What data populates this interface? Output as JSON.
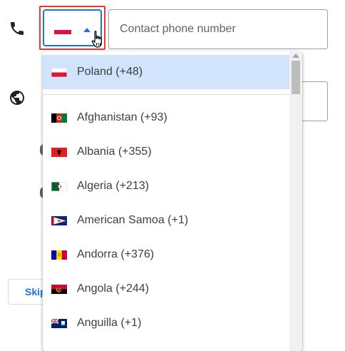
{
  "phone": {
    "icon": "phone-icon",
    "placeholder": "Contact phone number",
    "value": ""
  },
  "country_selector": {
    "selected_flag": "Poland",
    "arrow": "caret-up-icon"
  },
  "location": {
    "icon": "globe-icon"
  },
  "skip_button": {
    "label": "Skip"
  },
  "dropdown": {
    "selected": {
      "label": "Poland (+48)",
      "flag": "Poland"
    },
    "options": [
      {
        "label": "Afghanistan (+93)",
        "flag": "Afghanistan"
      },
      {
        "label": "Albania (+355)",
        "flag": "Albania"
      },
      {
        "label": "Algeria (+213)",
        "flag": "Algeria"
      },
      {
        "label": "American Samoa (+1)",
        "flag": "American Samoa"
      },
      {
        "label": "Andorra (+376)",
        "flag": "Andorra"
      },
      {
        "label": "Angola (+244)",
        "flag": "Angola"
      },
      {
        "label": "Anguilla (+1)",
        "flag": "Anguilla"
      }
    ]
  },
  "colors": {
    "accent": "#1a73e8",
    "highlight": "#e53935",
    "selected_bg": "#d2e3fc"
  }
}
